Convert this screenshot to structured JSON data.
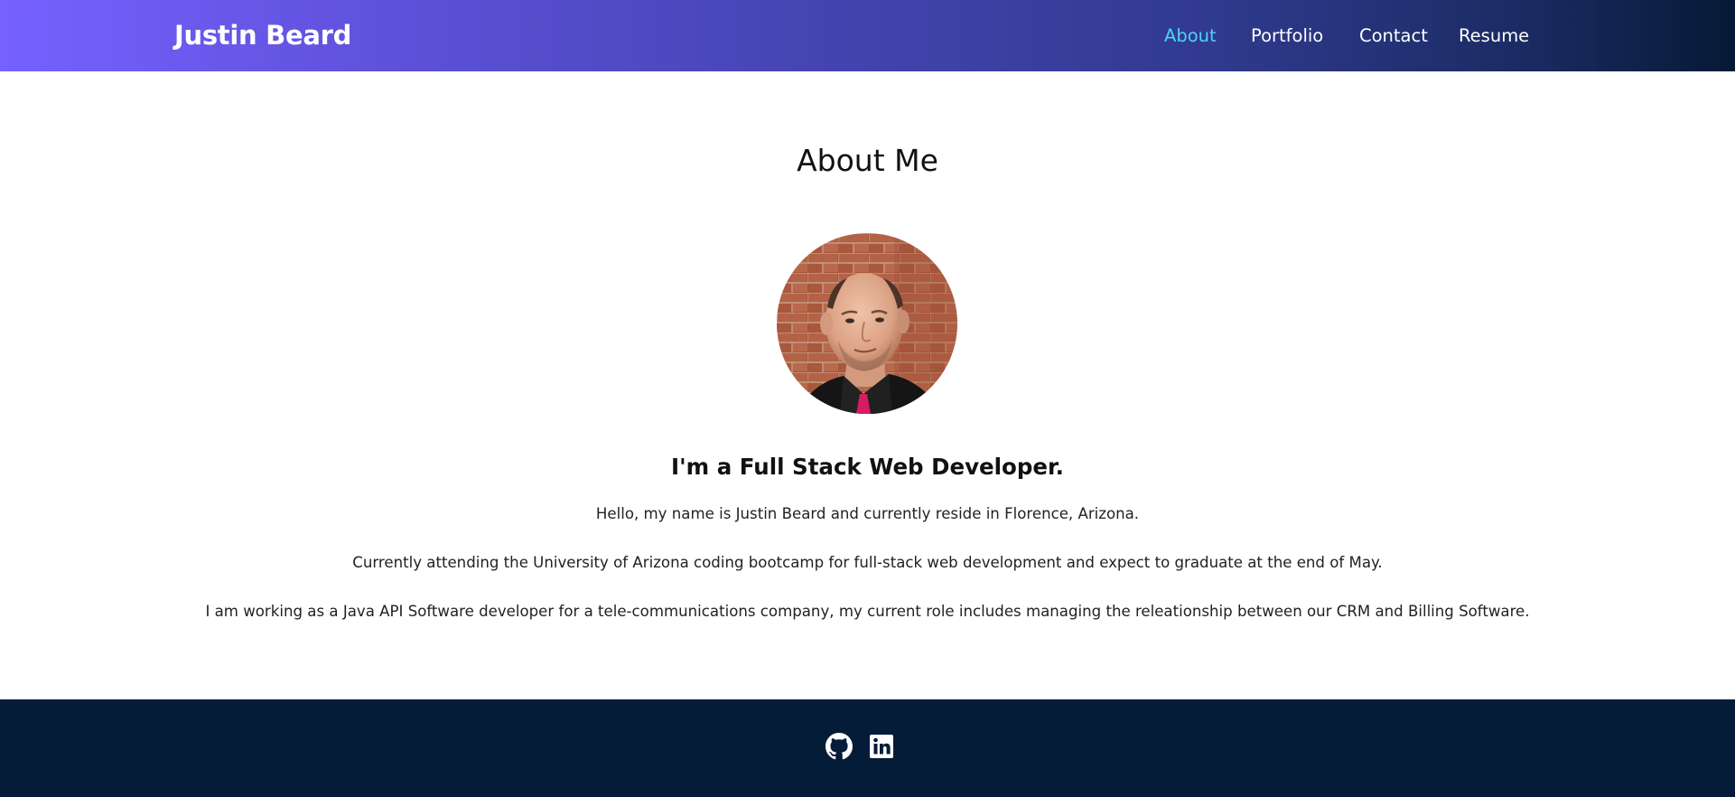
{
  "header": {
    "brand": "Justin Beard",
    "nav": [
      {
        "label": "About",
        "active": true
      },
      {
        "label": "Portfolio",
        "active": false
      },
      {
        "label": "Contact",
        "active": false
      },
      {
        "label": "Resume",
        "active": false
      }
    ]
  },
  "main": {
    "title": "About Me",
    "subtitle": "I'm a Full Stack Web Developer.",
    "paragraphs": [
      "Hello, my name is Justin Beard and currently reside in Florence, Arizona.",
      "Currently attending the University of Arizona coding bootcamp for full-stack web development and expect to graduate at the end of May.",
      "I am working as a Java API Software developer for a tele-communications company, my current role includes managing the releationship between our CRM and Billing Software."
    ]
  },
  "footer": {
    "icons": [
      "github-icon",
      "linkedin-icon"
    ]
  },
  "colors": {
    "nav_active": "#4fd2f5",
    "header_gradient_start": "#7661ff",
    "header_gradient_end": "#041a35",
    "footer_bg": "#041c37"
  }
}
